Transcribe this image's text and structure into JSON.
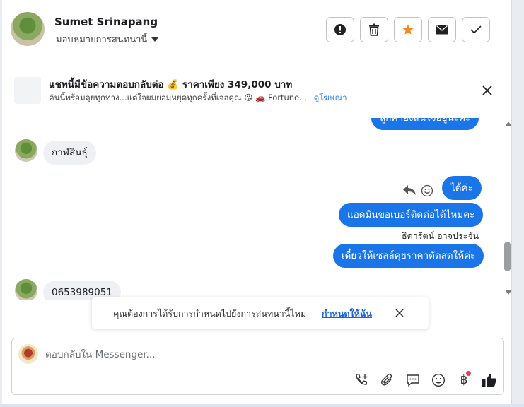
{
  "header": {
    "contact_name": "Sumet Srinapang",
    "assign_label": "มอบหมายการสนทนานี้",
    "buttons": [
      "report-spam",
      "delete",
      "star",
      "mark-unread",
      "mark-done"
    ],
    "star_color": "#f5871f"
  },
  "ad": {
    "title": "แชทนี้มีข้อความตอบกลับต่อ 💰 ราคาเพียง 349,000 บาท",
    "subtitle": "คันนี้พร้อมลุยทุกทาง...แต่ใจผมยอมหยุดทุกครั้งที่เจอคุณ 😘 🚗 Fortune...",
    "link_label": "ดูโฆษณา"
  },
  "chat": {
    "partial_top_bubble": "ลูกค้ายังสนใจอยู่นะคะ",
    "messages": [
      {
        "side": "in",
        "text": "กาฬสินธุ์"
      },
      {
        "side": "out",
        "text": "ได้ค่ะ"
      },
      {
        "side": "out",
        "text": "แอดมินขอเบอร์ติดต่อได้ไหมคะ"
      },
      {
        "side": "out",
        "text": "เดี๋ยวให้เซลล์คุยราคาตัดสดให้ค่ะ",
        "sender": "ธิดารัตน์ อาจประจัน"
      },
      {
        "side": "in",
        "text": "0653989051"
      }
    ],
    "accent": "#1a75e8"
  },
  "toast": {
    "text": "คุณต้องการได้รับการกำหนดไปยังการสนทนานี้ไหม",
    "link_label": "กำหนดให้ฉัน"
  },
  "composer": {
    "placeholder": "ตอบกลับใน Messenger...",
    "tools": [
      "call-add",
      "attach",
      "saved-reply",
      "emoji",
      "payment-baht",
      "like"
    ],
    "baht_symbol": "฿"
  }
}
